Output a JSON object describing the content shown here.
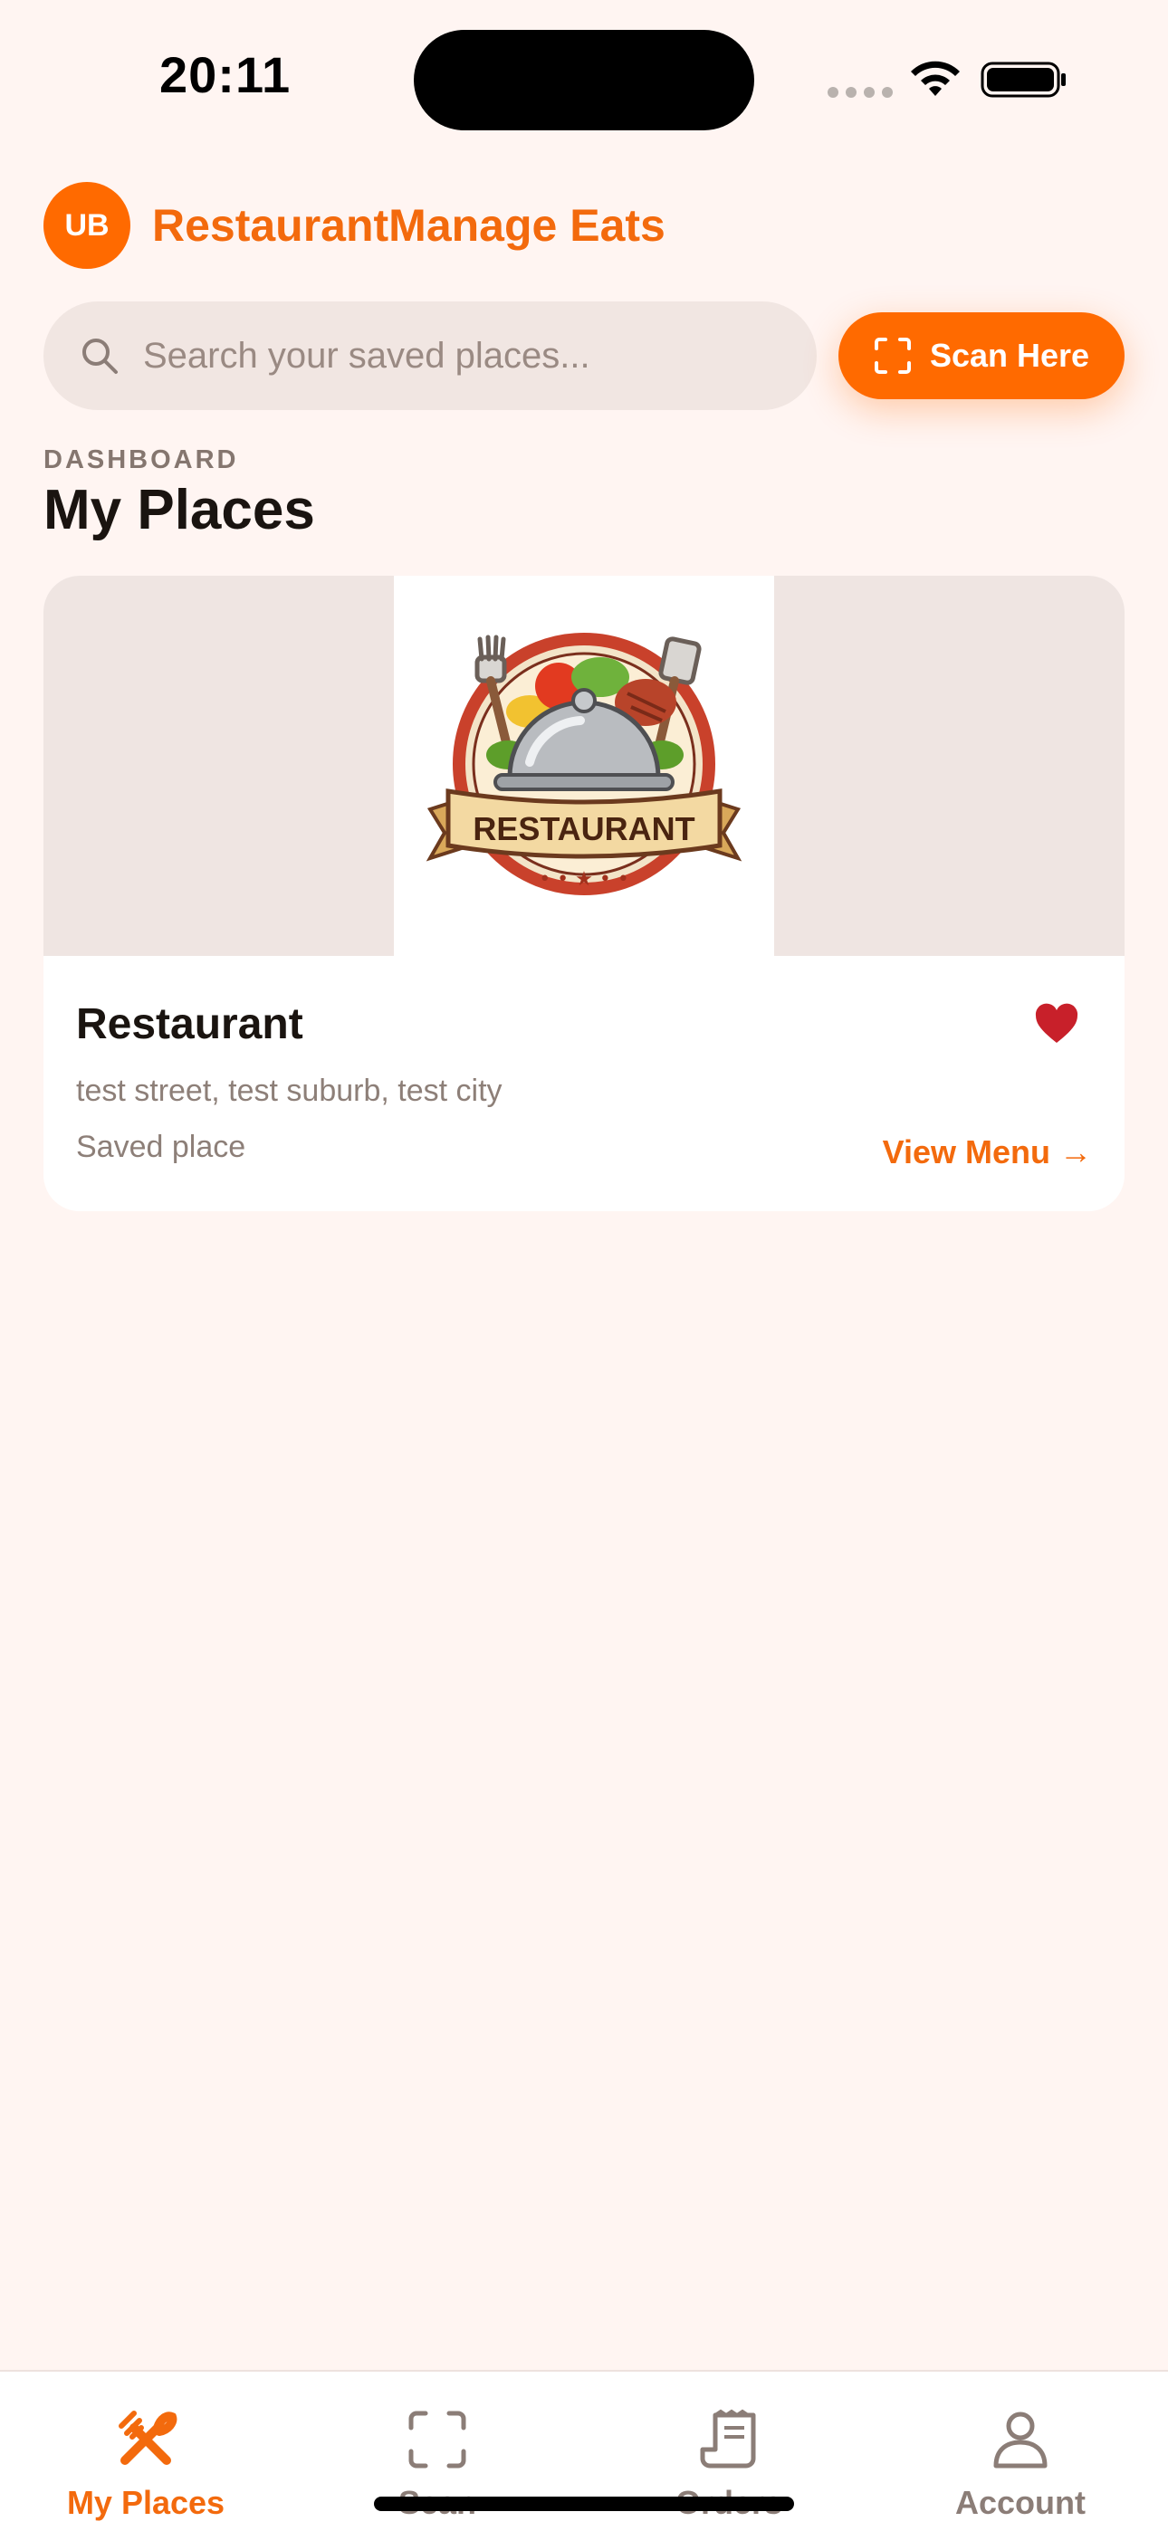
{
  "status_bar": {
    "time": "20:11"
  },
  "header": {
    "avatar_initials": "UB",
    "app_title": "RestaurantManage Eats"
  },
  "search": {
    "placeholder": "Search your saved places...",
    "value": ""
  },
  "scan_button": {
    "label": "Scan Here"
  },
  "section": {
    "eyebrow": "DASHBOARD",
    "title": "My Places"
  },
  "places": [
    {
      "name": "Restaurant",
      "address": "test street, test suburb, test city",
      "status": "Saved place",
      "favorited": true,
      "action_label": "View Menu →",
      "logo_text": "RESTAURANT"
    }
  ],
  "tabs": [
    {
      "label": "My Places",
      "icon": "fork-knife-icon",
      "active": true
    },
    {
      "label": "Scan",
      "icon": "scan-icon",
      "active": false
    },
    {
      "label": "Orders",
      "icon": "receipt-icon",
      "active": false
    },
    {
      "label": "Account",
      "icon": "person-icon",
      "active": false
    }
  ],
  "colors": {
    "accent": "#ff6a00",
    "accent_text": "#f36a0d",
    "background": "#fff5f2",
    "heart": "#c8202a"
  }
}
